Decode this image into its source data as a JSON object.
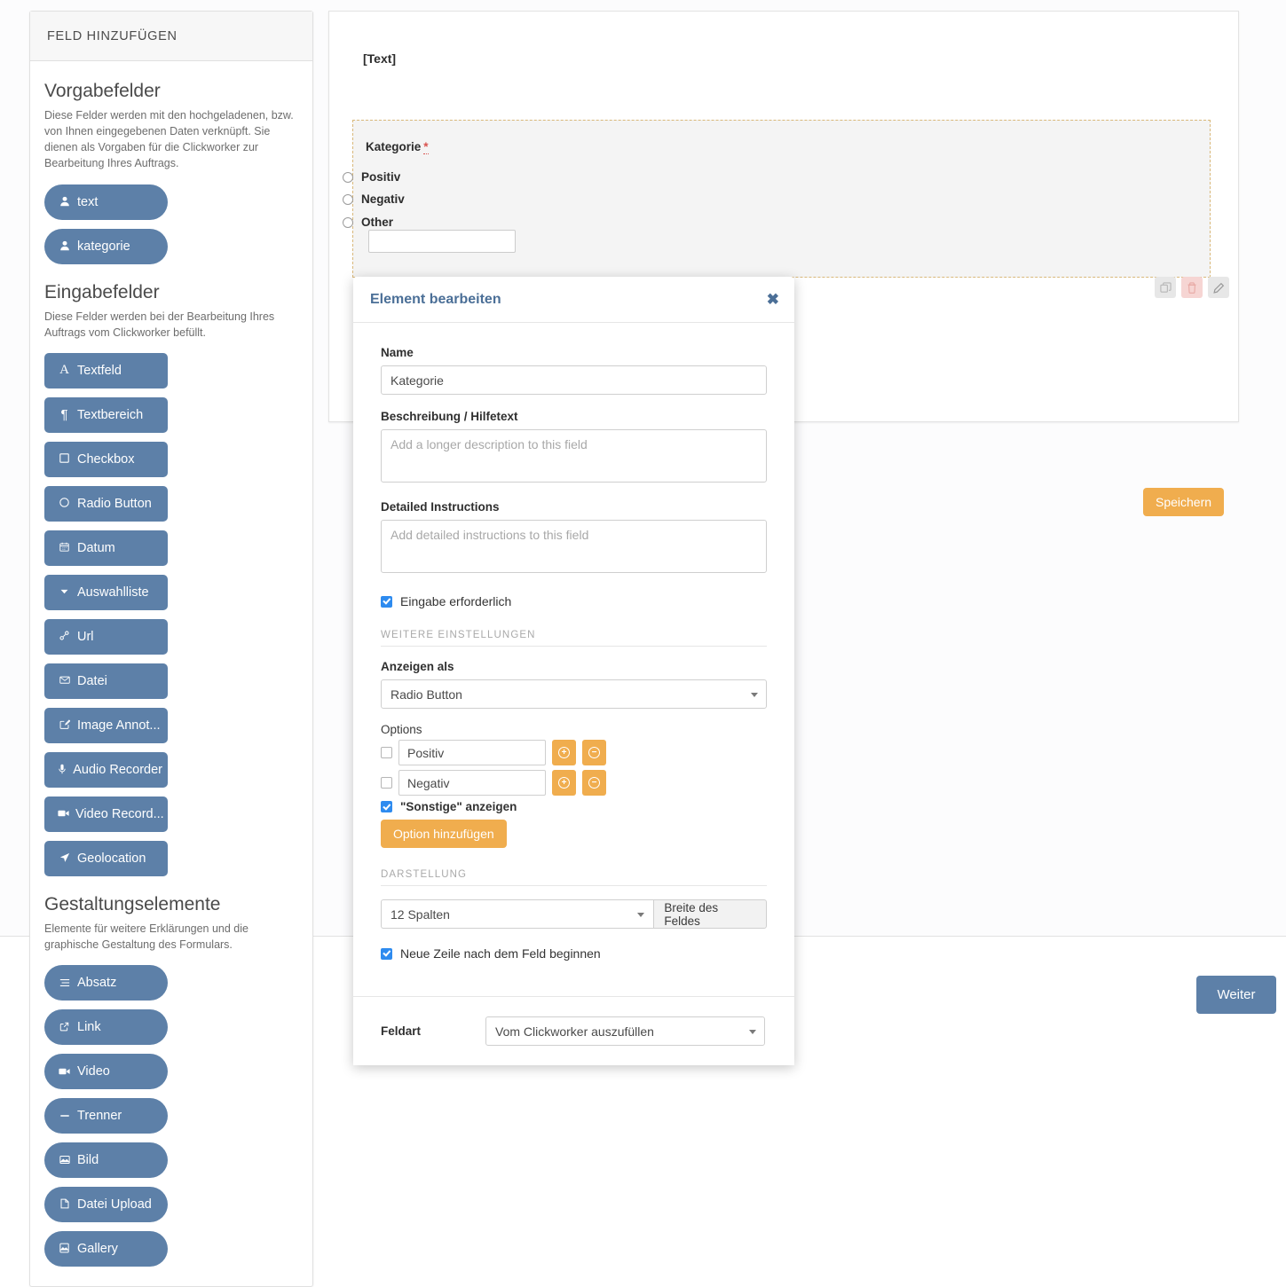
{
  "sidebar": {
    "header": "FELD HINZUFÜGEN",
    "sections": [
      {
        "title": "Vorgabefelder",
        "description": "Diese Felder werden mit den hochgeladenen, bzw. von Ihnen eingegebenen Daten verknüpft. Sie dienen als Vorgaben für die Clickworker zur Bearbeitung Ihres Auftrags.",
        "buttons": [
          {
            "label": "text",
            "icon": "user-icon",
            "glyph": "♟"
          },
          {
            "label": "kategorie",
            "icon": "user-icon",
            "glyph": "♟"
          }
        ]
      },
      {
        "title": "Eingabefelder",
        "description": "Diese Felder werden bei der Bearbeitung Ihres Auftrags vom Clickworker befüllt.",
        "buttons": [
          {
            "label": "Textfeld",
            "icon": "text-field-icon",
            "glyph": "A"
          },
          {
            "label": "Textbereich",
            "icon": "paragraph-icon",
            "glyph": "¶"
          },
          {
            "label": "Checkbox",
            "icon": "checkbox-icon",
            "glyph": "□"
          },
          {
            "label": "Radio Button",
            "icon": "radio-icon",
            "glyph": "○"
          },
          {
            "label": "Datum",
            "icon": "calendar-icon",
            "glyph": "▦"
          },
          {
            "label": "Auswahlliste",
            "icon": "caret-down-icon",
            "glyph": "▼"
          },
          {
            "label": "Url",
            "icon": "link-chain-icon",
            "glyph": "%"
          },
          {
            "label": "Datei",
            "icon": "envelope-icon",
            "glyph": "✉"
          },
          {
            "label": "Image Annot...",
            "icon": "image-annotate-icon",
            "glyph": "✎"
          },
          {
            "label": "Audio Recorder",
            "icon": "microphone-icon",
            "glyph": "Ƭ"
          },
          {
            "label": "Video Record...",
            "icon": "video-camera-icon",
            "glyph": "■"
          },
          {
            "label": "Geolocation",
            "icon": "location-arrow-icon",
            "glyph": "➤"
          }
        ]
      },
      {
        "title": "Gestaltungselemente",
        "description": "Elemente für weitere Erklärungen und die graphische Gestaltung des Formulars.",
        "buttons": [
          {
            "label": "Absatz",
            "icon": "align-lines-icon",
            "glyph": "≡"
          },
          {
            "label": "Link",
            "icon": "external-link-icon",
            "glyph": "↗"
          },
          {
            "label": "Video",
            "icon": "video-camera-icon",
            "glyph": "■"
          },
          {
            "label": "Trenner",
            "icon": "divider-icon",
            "glyph": "—"
          },
          {
            "label": "Bild",
            "icon": "image-icon",
            "glyph": "⛰"
          },
          {
            "label": "Datei Upload",
            "icon": "file-icon",
            "glyph": "▯"
          },
          {
            "label": "Gallery",
            "icon": "gallery-icon",
            "glyph": "⛰"
          }
        ]
      }
    ]
  },
  "preview": {
    "text_placeholder": "[Text]",
    "field": {
      "label": "Kategorie",
      "required_marker": "*",
      "options": [
        "Positiv",
        "Negativ",
        "Other"
      ],
      "other_input_value": ""
    },
    "actions": [
      {
        "name": "copy-element-button",
        "glyph": "⧉"
      },
      {
        "name": "delete-element-button",
        "glyph": "Ὕ1"
      },
      {
        "name": "edit-element-button",
        "glyph": "✎"
      }
    ]
  },
  "buttons": {
    "save": "Speichern",
    "next": "Weiter"
  },
  "modal": {
    "title": "Element bearbeiten",
    "close_glyph": "✖",
    "name_label": "Name",
    "name_value": "Kategorie",
    "description_label": "Beschreibung / Hilfetext",
    "description_placeholder": "Add a longer description to this field",
    "description_value": "",
    "instructions_label": "Detailed Instructions",
    "instructions_placeholder": "Add detailed instructions to this field",
    "instructions_value": "",
    "required_checkbox_label": "Eingabe erforderlich",
    "required_checked": true,
    "more_settings_label": "WEITERE EINSTELLUNGEN",
    "display_as_label": "Anzeigen als",
    "display_as_value": "Radio Button",
    "options_label": "Options",
    "options": [
      {
        "value": "Positiv",
        "checked": false
      },
      {
        "value": "Negativ",
        "checked": false
      }
    ],
    "show_other_label": "\"Sonstige\" anzeigen",
    "show_other_checked": true,
    "add_option_label": "Option hinzufügen",
    "presentation_label": "DARSTELLUNG",
    "columns_value": "12 Spalten",
    "width_addon_label": "Breite des Feldes",
    "newline_label": "Neue Zeile nach dem Feld beginnen",
    "newline_checked": true,
    "feldart_label": "Feldart",
    "feldart_value": "Vom Clickworker auszufüllen"
  },
  "colors": {
    "accent_blue": "#5d80a8",
    "accent_orange": "#f0ad4e",
    "modal_title_blue": "#4b6f97",
    "required_red": "#d9534f",
    "checkbox_blue": "#2e8bef",
    "dashed_border": "#d9b87a"
  }
}
